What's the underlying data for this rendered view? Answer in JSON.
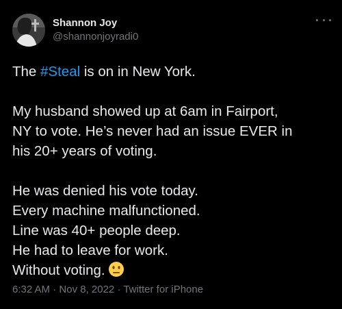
{
  "author": {
    "display_name": "Shannon Joy",
    "handle": "@shannonjoyradi0",
    "avatar_icon": "profile-photo"
  },
  "tweet": {
    "line1_prefix": "The ",
    "hashtag": "#Steal",
    "line1_suffix": " is on in New York.",
    "para2": [
      "My husband showed up at 6am in Fairport,",
      "NY to vote. He’s never had an issue EVER in",
      "his 20+ years of voting."
    ],
    "para3": [
      "He was denied his vote today.",
      "Every machine malfunctioned.",
      "Line was 40+ people deep.",
      "He had to leave for work."
    ],
    "last_line": "Without voting.",
    "emoji_name": "neutral-face-emoji"
  },
  "meta": {
    "time": "6:32 AM",
    "sep1": " · ",
    "date": "Nov 8, 2022",
    "sep2": " · ",
    "source": "Twitter for iPhone"
  },
  "colors": {
    "background": "#000000",
    "text": "#e7e9ea",
    "secondary": "#71767b",
    "link": "#1d9bf0"
  }
}
